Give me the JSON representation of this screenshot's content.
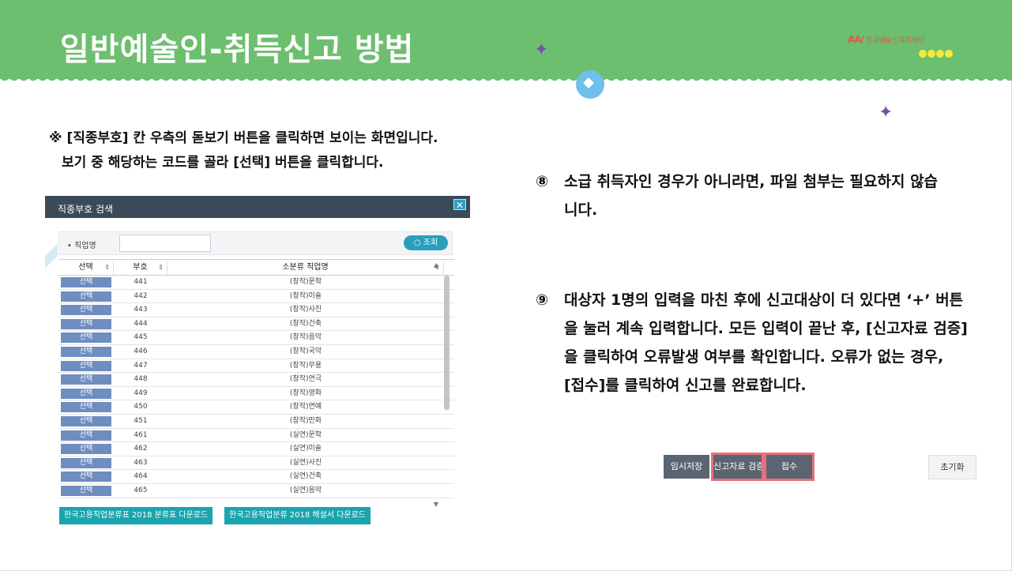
{
  "header": {
    "title": "일반예술인-취득신고 방법",
    "logo_mark": "AA/",
    "logo_text": "한국예술인복지재단"
  },
  "note": {
    "line1": "※ [직종부호] 칸 우측의 돋보기 버튼을 클릭하면 보이는 화면입니다.",
    "line2": "보기 중 해당하는 코드를 골라 [선택] 버튼을 클릭합니다."
  },
  "dialog": {
    "title": "직종부호 검색",
    "close": "✕",
    "search_label": "• 직업명",
    "search_placeholder": "",
    "search_button": "조회",
    "columns": [
      "선택",
      "부호",
      "소분류 직업명"
    ],
    "select_label": "선택",
    "rows": [
      {
        "code": "441",
        "name": "(창작)문학"
      },
      {
        "code": "442",
        "name": "(창작)미술"
      },
      {
        "code": "443",
        "name": "(창작)사진"
      },
      {
        "code": "444",
        "name": "(창작)건축"
      },
      {
        "code": "445",
        "name": "(창작)음악"
      },
      {
        "code": "446",
        "name": "(창작)국악"
      },
      {
        "code": "447",
        "name": "(창작)무용"
      },
      {
        "code": "448",
        "name": "(창작)연극"
      },
      {
        "code": "449",
        "name": "(창작)영화"
      },
      {
        "code": "450",
        "name": "(창작)연예"
      },
      {
        "code": "451",
        "name": "(창작)만화"
      },
      {
        "code": "461",
        "name": "(실연)문학"
      },
      {
        "code": "462",
        "name": "(실연)미술"
      },
      {
        "code": "463",
        "name": "(실연)사진"
      },
      {
        "code": "464",
        "name": "(실연)건축"
      },
      {
        "code": "465",
        "name": "(실연)음악"
      }
    ],
    "download1": "한국고용직업분류표 2018 분류표 다운로드",
    "download2": "한국고용직업분류 2018 해설서 다운로드"
  },
  "steps": {
    "s8_num": "⑧",
    "s8_line1": "소급 취득자인 경우가 아니라면, 파일 첨부는 필요하지 않습",
    "s8_line2": "니다.",
    "s9_num": "⑨",
    "s9_line1": "대상자 1명의 입력을 마친 후에 신고대상이 더 있다면 ‘+’ 버튼",
    "s9_line2": "을 눌러 계속 입력합니다. 모든 입력이 끝난 후, [신고자료 검증]",
    "s9_line3": "을 클릭하여 오류발생 여부를 확인합니다. 오류가 없는 경우,",
    "s9_line4": "[접수]를 클릭하여 신고를 완료합니다."
  },
  "actions": {
    "temp_save": "임시저장",
    "verify": "신고자료 검증",
    "submit": "접수",
    "reset": "초기화"
  },
  "colors": {
    "header_green": "#6cbf6f",
    "star_purple": "#7b4fa8",
    "select_blue": "#6f8dbf",
    "download_teal": "#1aa4ae",
    "highlight_red": "#e4707c"
  }
}
